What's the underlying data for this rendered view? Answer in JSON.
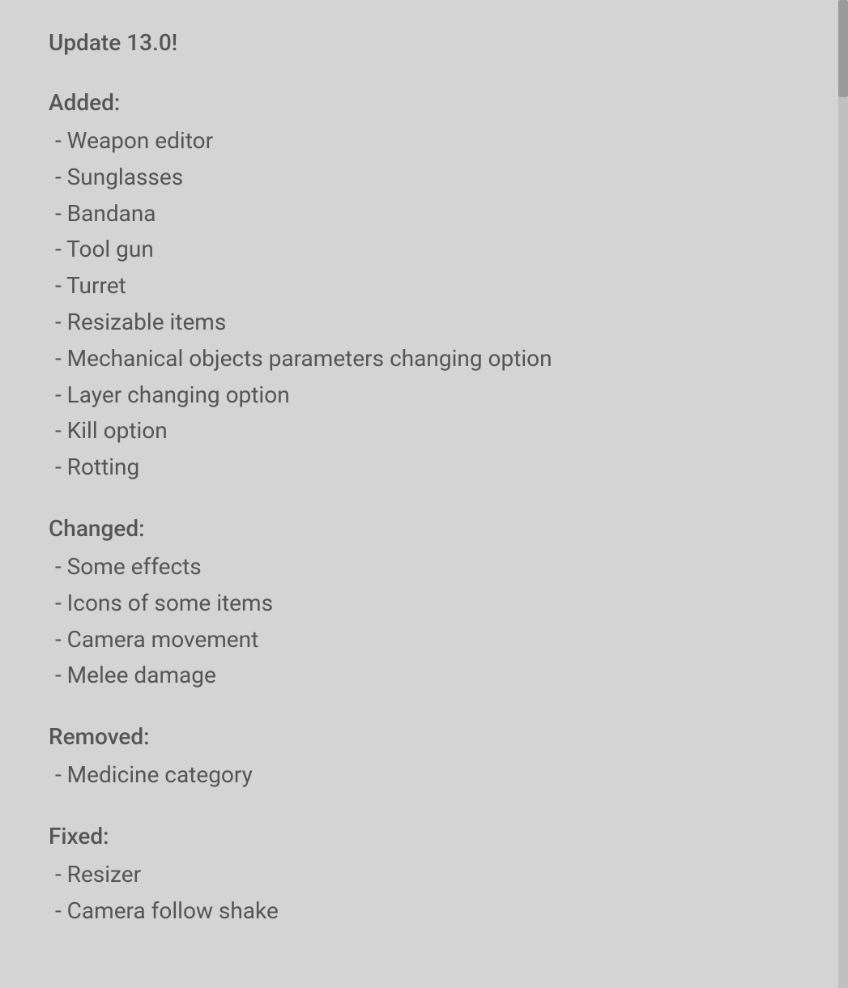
{
  "page": {
    "title": "Update 13.0!",
    "sections": [
      {
        "heading": "Added:",
        "items": [
          "- Weapon editor",
          "- Sunglasses",
          "- Bandana",
          "- Tool gun",
          "- Turret",
          "- Resizable items",
          "- Mechanical objects parameters changing option",
          "- Layer changing option",
          "- Kill option",
          "- Rotting"
        ]
      },
      {
        "heading": "Changed:",
        "items": [
          "- Some effects",
          "- Icons of some items",
          "- Camera movement",
          "- Melee damage"
        ]
      },
      {
        "heading": "Removed:",
        "items": [
          "- Medicine category"
        ]
      },
      {
        "heading": "Fixed:",
        "items": [
          "- Resizer",
          "- Camera follow shake"
        ]
      }
    ]
  }
}
